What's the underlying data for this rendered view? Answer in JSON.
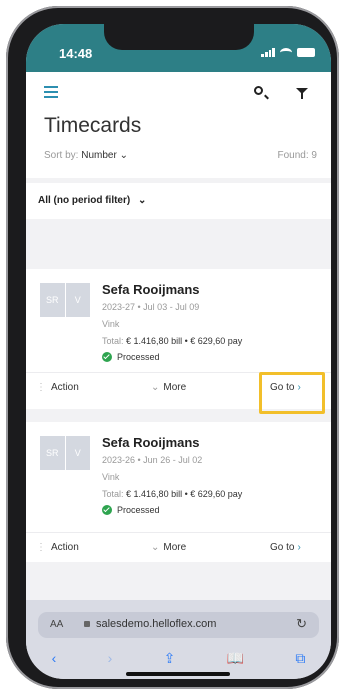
{
  "status": {
    "time": "14:48"
  },
  "page": {
    "title": "Timecards",
    "sort_label": "Sort by:",
    "sort_value": "Number",
    "found": "Found: 9",
    "period_filter": "All (no period filter)"
  },
  "cards": [
    {
      "initials_left": "SR",
      "initials_right": "V",
      "name": "Sefa Rooijmans",
      "period": "2023-27 • Jul 03 - Jul 09",
      "group": "Vink",
      "total_label": "Total:",
      "total_value": "€ 1.416,80 bill • € 629,60 pay",
      "status": "Processed",
      "action_label": "Action",
      "more_label": "More",
      "goto_label": "Go to"
    },
    {
      "initials_left": "SR",
      "initials_right": "V",
      "name": "Sefa Rooijmans",
      "period": "2023-26 • Jun 26 - Jul 02",
      "group": "Vink",
      "total_label": "Total:",
      "total_value": "€ 1.416,80 bill • € 629,60 pay",
      "status": "Processed",
      "action_label": "Action",
      "more_label": "More",
      "goto_label": "Go to"
    }
  ],
  "browser": {
    "aa": "AA",
    "url": "salesdemo.helloflex.com",
    "nav": [
      "‹",
      "›",
      "⇪",
      "📖",
      "⧉"
    ]
  },
  "colors": {
    "accent": "#2d7f86",
    "highlight": "#f2bf2a",
    "processed": "#2ea44f"
  }
}
